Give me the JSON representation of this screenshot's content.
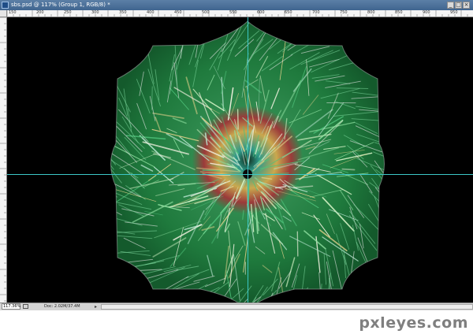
{
  "window": {
    "title": "sbs.psd @ 117% (Group 1, RGB/8) *",
    "buttons": [
      "minimize-button",
      "maximize-button",
      "close-button"
    ]
  },
  "ruler_top_labels": [
    "150",
    "200",
    "250",
    "300",
    "350",
    "400",
    "450",
    "500",
    "550",
    "600",
    "650",
    "700",
    "750",
    "800",
    "850",
    "900",
    "950"
  ],
  "status": {
    "zoom": "117.36%",
    "doc_info": "Doc: 2.02M/37.4M",
    "arrow": "▸"
  },
  "watermark": "pxleyes.com",
  "colors": {
    "canvas": "#000000",
    "guide": "#3cc7c7",
    "outer_green": "#1f7a3d",
    "mid_green": "#3aa862",
    "ring_red": "#9b3a3a",
    "ring_gold": "#c9a84e",
    "center_teal": "#2f9a8a"
  }
}
